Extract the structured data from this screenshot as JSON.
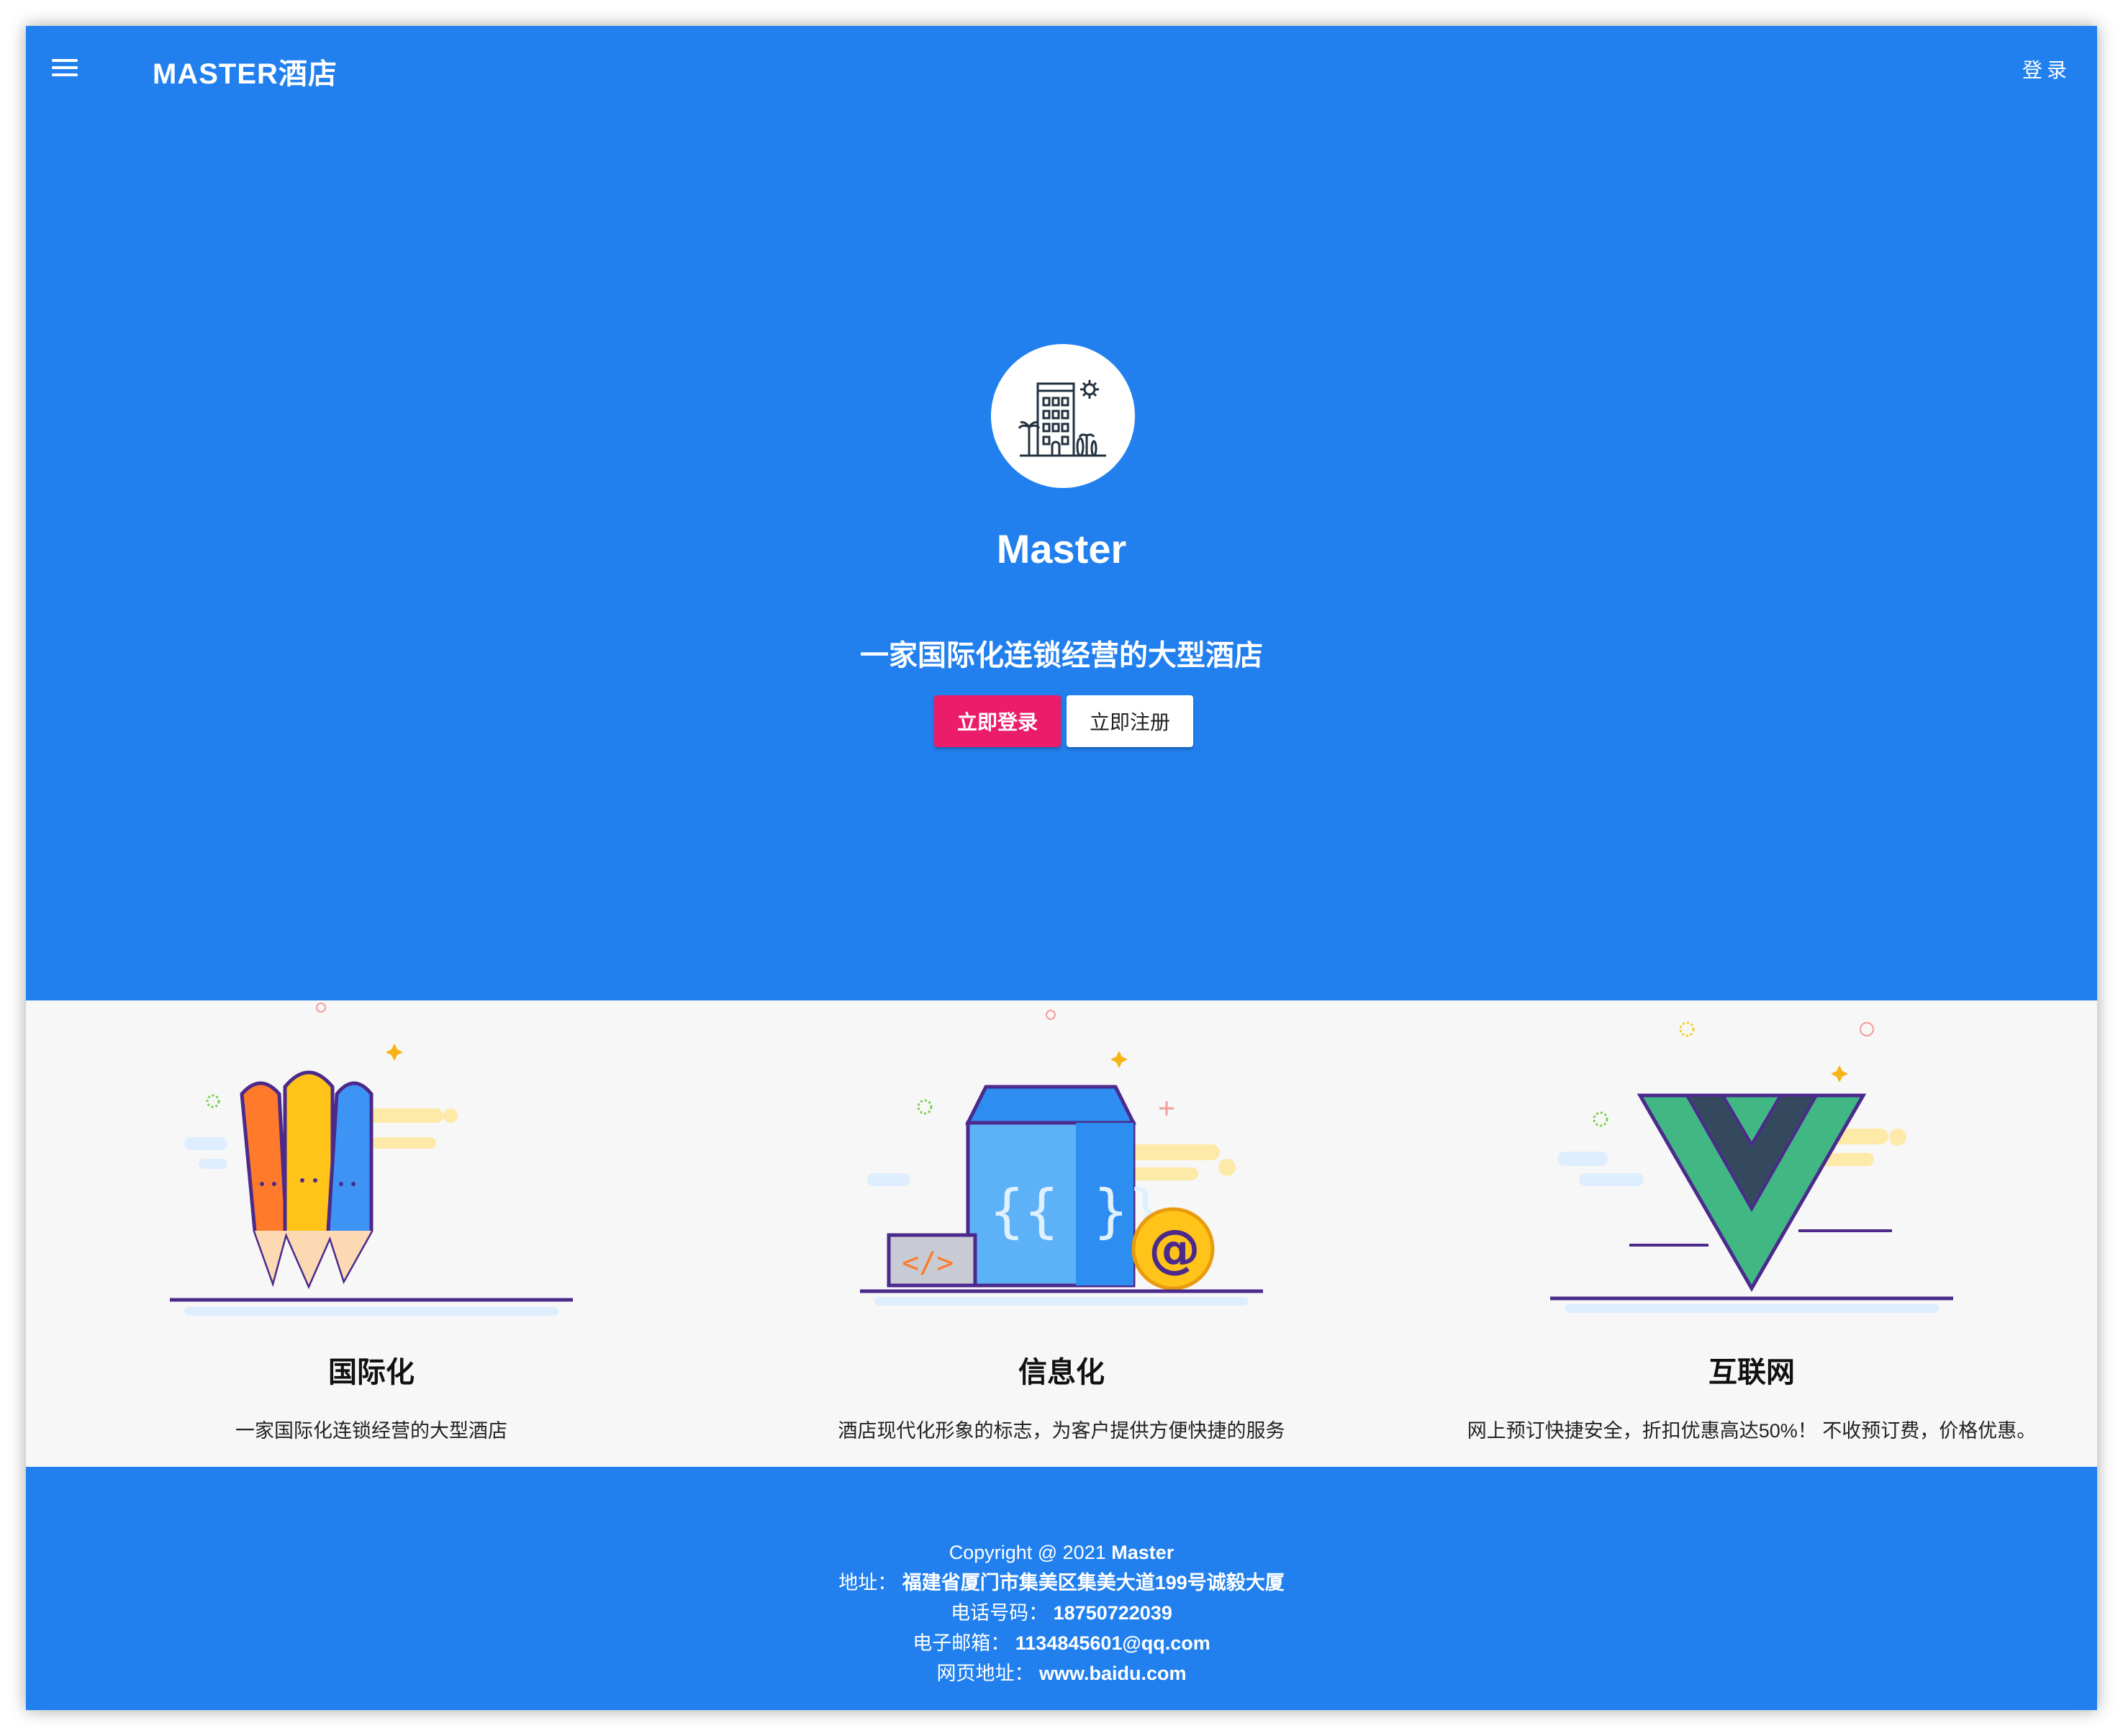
{
  "header": {
    "title": "MASTER酒店",
    "login_label": "登录"
  },
  "hero": {
    "title": "Master",
    "subtitle": "一家国际化连锁经营的大型酒店",
    "login_button": "立即登录",
    "register_button": "立即注册"
  },
  "features": [
    {
      "title": "国际化",
      "description": "一家国际化连锁经营的大型酒店"
    },
    {
      "title": "信息化",
      "description": "酒店现代化形象的标志，为客户提供方便快捷的服务"
    },
    {
      "title": "互联网",
      "description": "网上预订快捷安全，折扣优惠高达50%！ 不收预订费，价格优惠。"
    }
  ],
  "footer": {
    "copyright_prefix": "Copyright @ 2021 ",
    "copyright_name": "Master",
    "address_label": "地址：",
    "address_value": "福建省厦门市集美区集美大道199号诚毅大厦",
    "phone_label": "电话号码：",
    "phone_value": "18750722039",
    "email_label": "电子邮箱：",
    "email_value": "1134845601@qq.com",
    "web_label": "网页地址：",
    "web_value": "www.baidu.com"
  },
  "colors": {
    "primary": "#2180ee",
    "accent": "#eb1c6a"
  },
  "icons": [
    "menu-icon",
    "hotel-logo-icon",
    "pencils-illustration-icon",
    "box-code-illustration-icon",
    "vue-logo-illustration-icon"
  ]
}
